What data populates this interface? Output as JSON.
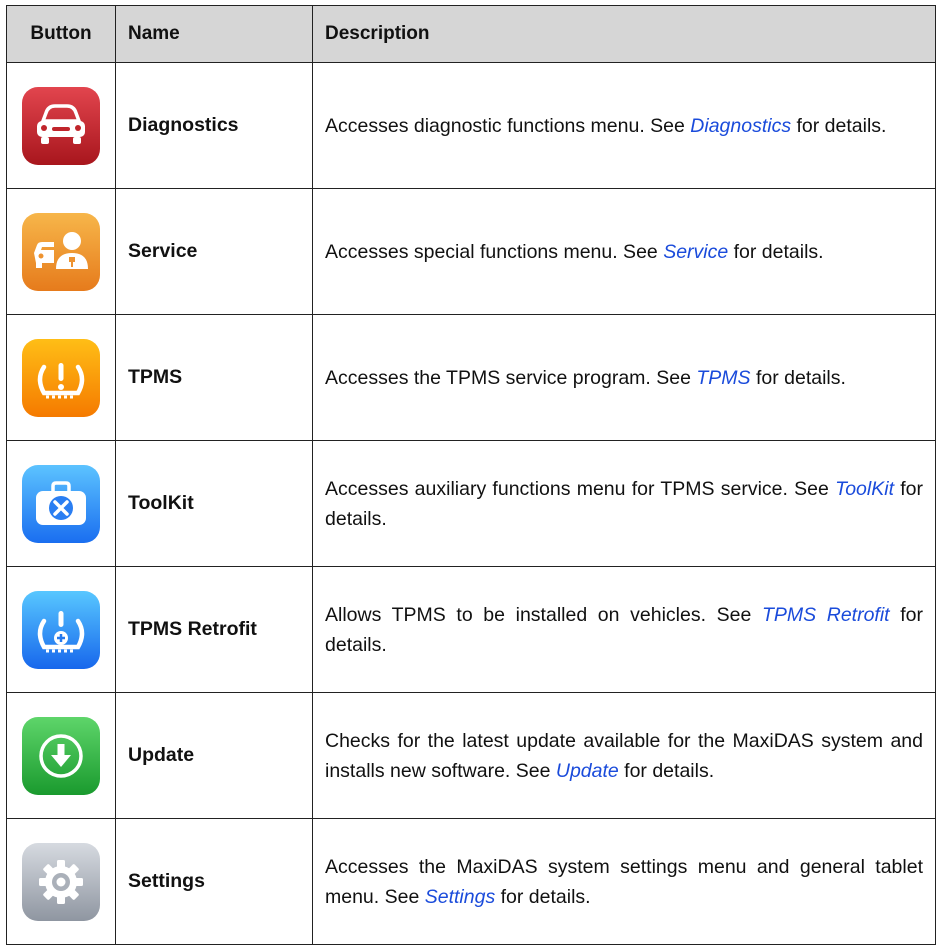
{
  "headers": {
    "button": "Button",
    "name": "Name",
    "description": "Description"
  },
  "rows": [
    {
      "icon": "car-front-icon",
      "name": "Diagnostics",
      "desc": [
        {
          "t": "Accesses diagnostic functions menu. See "
        },
        {
          "t": "Diagnostics",
          "link": true
        },
        {
          "t": " for details."
        }
      ]
    },
    {
      "icon": "car-mechanic-icon",
      "name": "Service",
      "desc": [
        {
          "t": "Accesses special functions menu. See "
        },
        {
          "t": "Service",
          "link": true
        },
        {
          "t": " for details."
        }
      ]
    },
    {
      "icon": "tire-pressure-icon",
      "name": "TPMS",
      "desc": [
        {
          "t": "Accesses the TPMS service program. See "
        },
        {
          "t": "TPMS",
          "link": true
        },
        {
          "t": " for details."
        }
      ]
    },
    {
      "icon": "toolbox-icon",
      "name": "ToolKit",
      "desc": [
        {
          "t": "Accesses auxiliary functions menu for TPMS service. See "
        },
        {
          "t": "ToolKit",
          "link": true
        },
        {
          "t": " for details."
        }
      ]
    },
    {
      "icon": "tire-retrofit-icon",
      "name": "TPMS Retrofit",
      "desc": [
        {
          "t": "Allows TPMS to be installed on vehicles. See "
        },
        {
          "t": "TPMS Retrofit",
          "link": true
        },
        {
          "t": " for details."
        }
      ]
    },
    {
      "icon": "download-arrow-icon",
      "name": "Update",
      "desc": [
        {
          "t": "Checks for the latest update available for the MaxiDAS system and installs new software. See "
        },
        {
          "t": "Update",
          "link": true
        },
        {
          "t": " for details."
        }
      ]
    },
    {
      "icon": "gear-icon",
      "name": "Settings",
      "desc": [
        {
          "t": "Accesses the MaxiDAS system settings menu and general tablet menu. See "
        },
        {
          "t": "Settings",
          "link": true
        },
        {
          "t": " for details."
        }
      ]
    }
  ]
}
